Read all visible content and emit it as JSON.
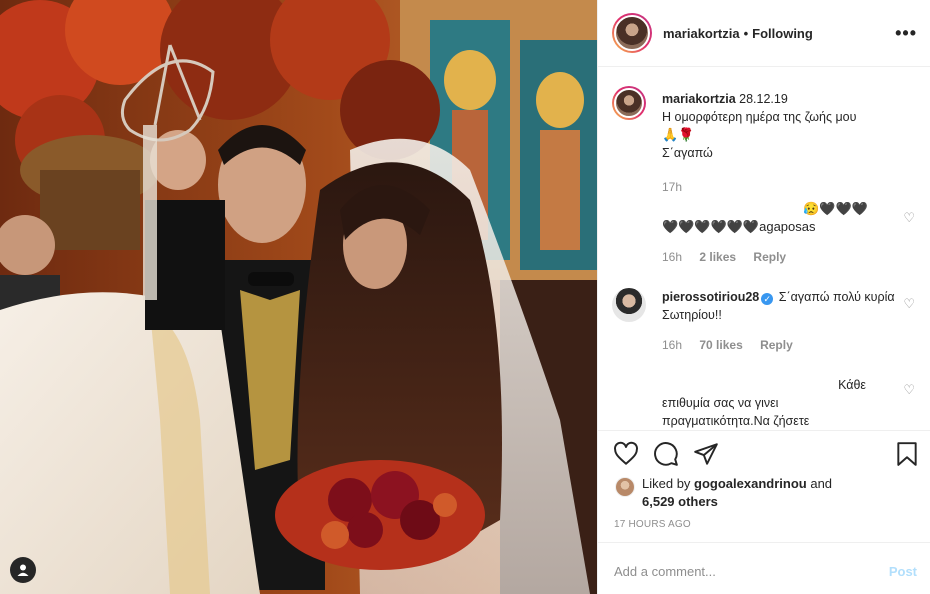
{
  "header": {
    "username": "mariakortzia",
    "separator": "•",
    "follow_status": "Following"
  },
  "caption": {
    "username": "mariakortzia",
    "date": "28.12.19",
    "line1": "Η ομορφότερη ημέρα της ζωής μου",
    "line1_emojis": "🙏🌹",
    "line2": "Σ΄αγαπώ",
    "time": "17h"
  },
  "comments": [
    {
      "username": "",
      "text_line1": "😥🖤🖤🖤",
      "text_line2": "🖤🖤🖤🖤🖤🖤agaposas",
      "time": "16h",
      "likes": "2 likes",
      "reply": "Reply"
    },
    {
      "username": "pierossotiriou28",
      "text": "Σ΄αγαπώ πολύ κυρία Σωτηρίου!!",
      "time": "16h",
      "likes": "70 likes",
      "reply": "Reply"
    },
    {
      "text_line1": "Κάθε",
      "text_line2": "επιθυμία σας να γινει",
      "text_line3": "πραγματικότητα.Να ζήσετε"
    }
  ],
  "liked_by": {
    "prefix": "Liked by",
    "user": "gogoalexandrinou",
    "and": "and",
    "others": "6,529 others"
  },
  "timestamp": "17 HOURS AGO",
  "add_comment": {
    "placeholder": "Add a comment...",
    "post_label": "Post"
  },
  "colors": {
    "link_blue": "#3897f0",
    "post_disabled": "#b2dffc",
    "meta_gray": "#8e8e8e",
    "text": "#262626"
  },
  "icons": [
    "more-options-icon",
    "heart-icon",
    "comment-icon",
    "share-icon",
    "bookmark-icon",
    "user-tag-icon",
    "verified-badge-icon"
  ]
}
